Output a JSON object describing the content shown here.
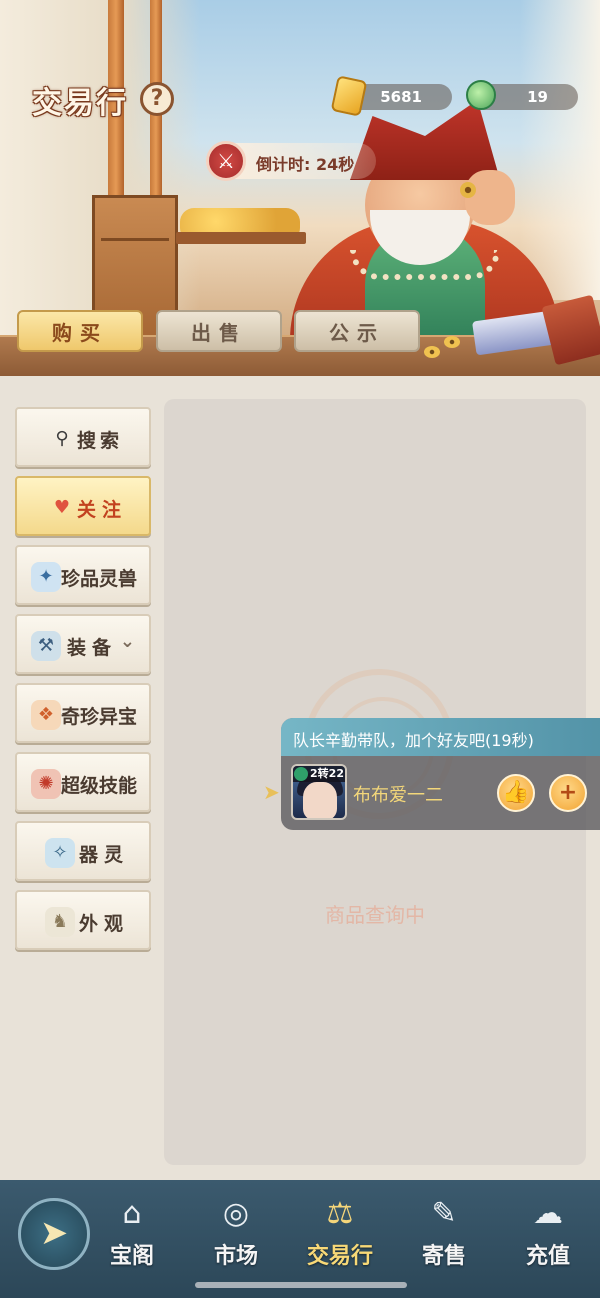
{
  "header": {
    "title": "交易行",
    "help_icon": "question-icon",
    "currencies": [
      {
        "icon": "gold-ingot-icon",
        "value": "5681"
      },
      {
        "icon": "jade-cloud-icon",
        "value": "19"
      }
    ],
    "countdown": {
      "icon": "crossed-swords-icon",
      "text": "倒计时: 24秒"
    }
  },
  "tabs": [
    {
      "label": "购买",
      "active": true
    },
    {
      "label": "出售",
      "active": false
    },
    {
      "label": "公示",
      "active": false
    }
  ],
  "menu": [
    {
      "label": "搜索",
      "icon": "search-icon",
      "active": false
    },
    {
      "label": "关注",
      "icon": "heart-icon",
      "active": true
    },
    {
      "label": "珍品灵兽",
      "icon": "spirit-beast-icon",
      "active": false
    },
    {
      "label": "装备",
      "icon": "equipment-icon",
      "active": false,
      "dropdown": true
    },
    {
      "label": "奇珍异宝",
      "icon": "treasure-icon",
      "active": false
    },
    {
      "label": "超级技能",
      "icon": "skill-scroll-icon",
      "active": false
    },
    {
      "label": "器灵",
      "icon": "artifact-spirit-icon",
      "active": false
    },
    {
      "label": "外观",
      "icon": "appearance-icon",
      "active": false
    }
  ],
  "content": {
    "status": "商品查询中"
  },
  "popup": {
    "message": "队长辛勤带队，加个好友吧(19秒)",
    "level": "2转22",
    "player_name": "布布爱一二",
    "like_icon": "thumbs-up-icon",
    "add_icon": "plus-icon"
  },
  "nav": {
    "back_icon": "compass-arrow-icon",
    "items": [
      {
        "label": "宝阁",
        "icon": "pavilion-icon",
        "active": false
      },
      {
        "label": "市场",
        "icon": "coin-icon",
        "active": false
      },
      {
        "label": "交易行",
        "icon": "scale-icon",
        "active": true
      },
      {
        "label": "寄售",
        "icon": "scroll-icon",
        "active": false
      },
      {
        "label": "充值",
        "icon": "cloud-icon",
        "active": false
      }
    ]
  }
}
